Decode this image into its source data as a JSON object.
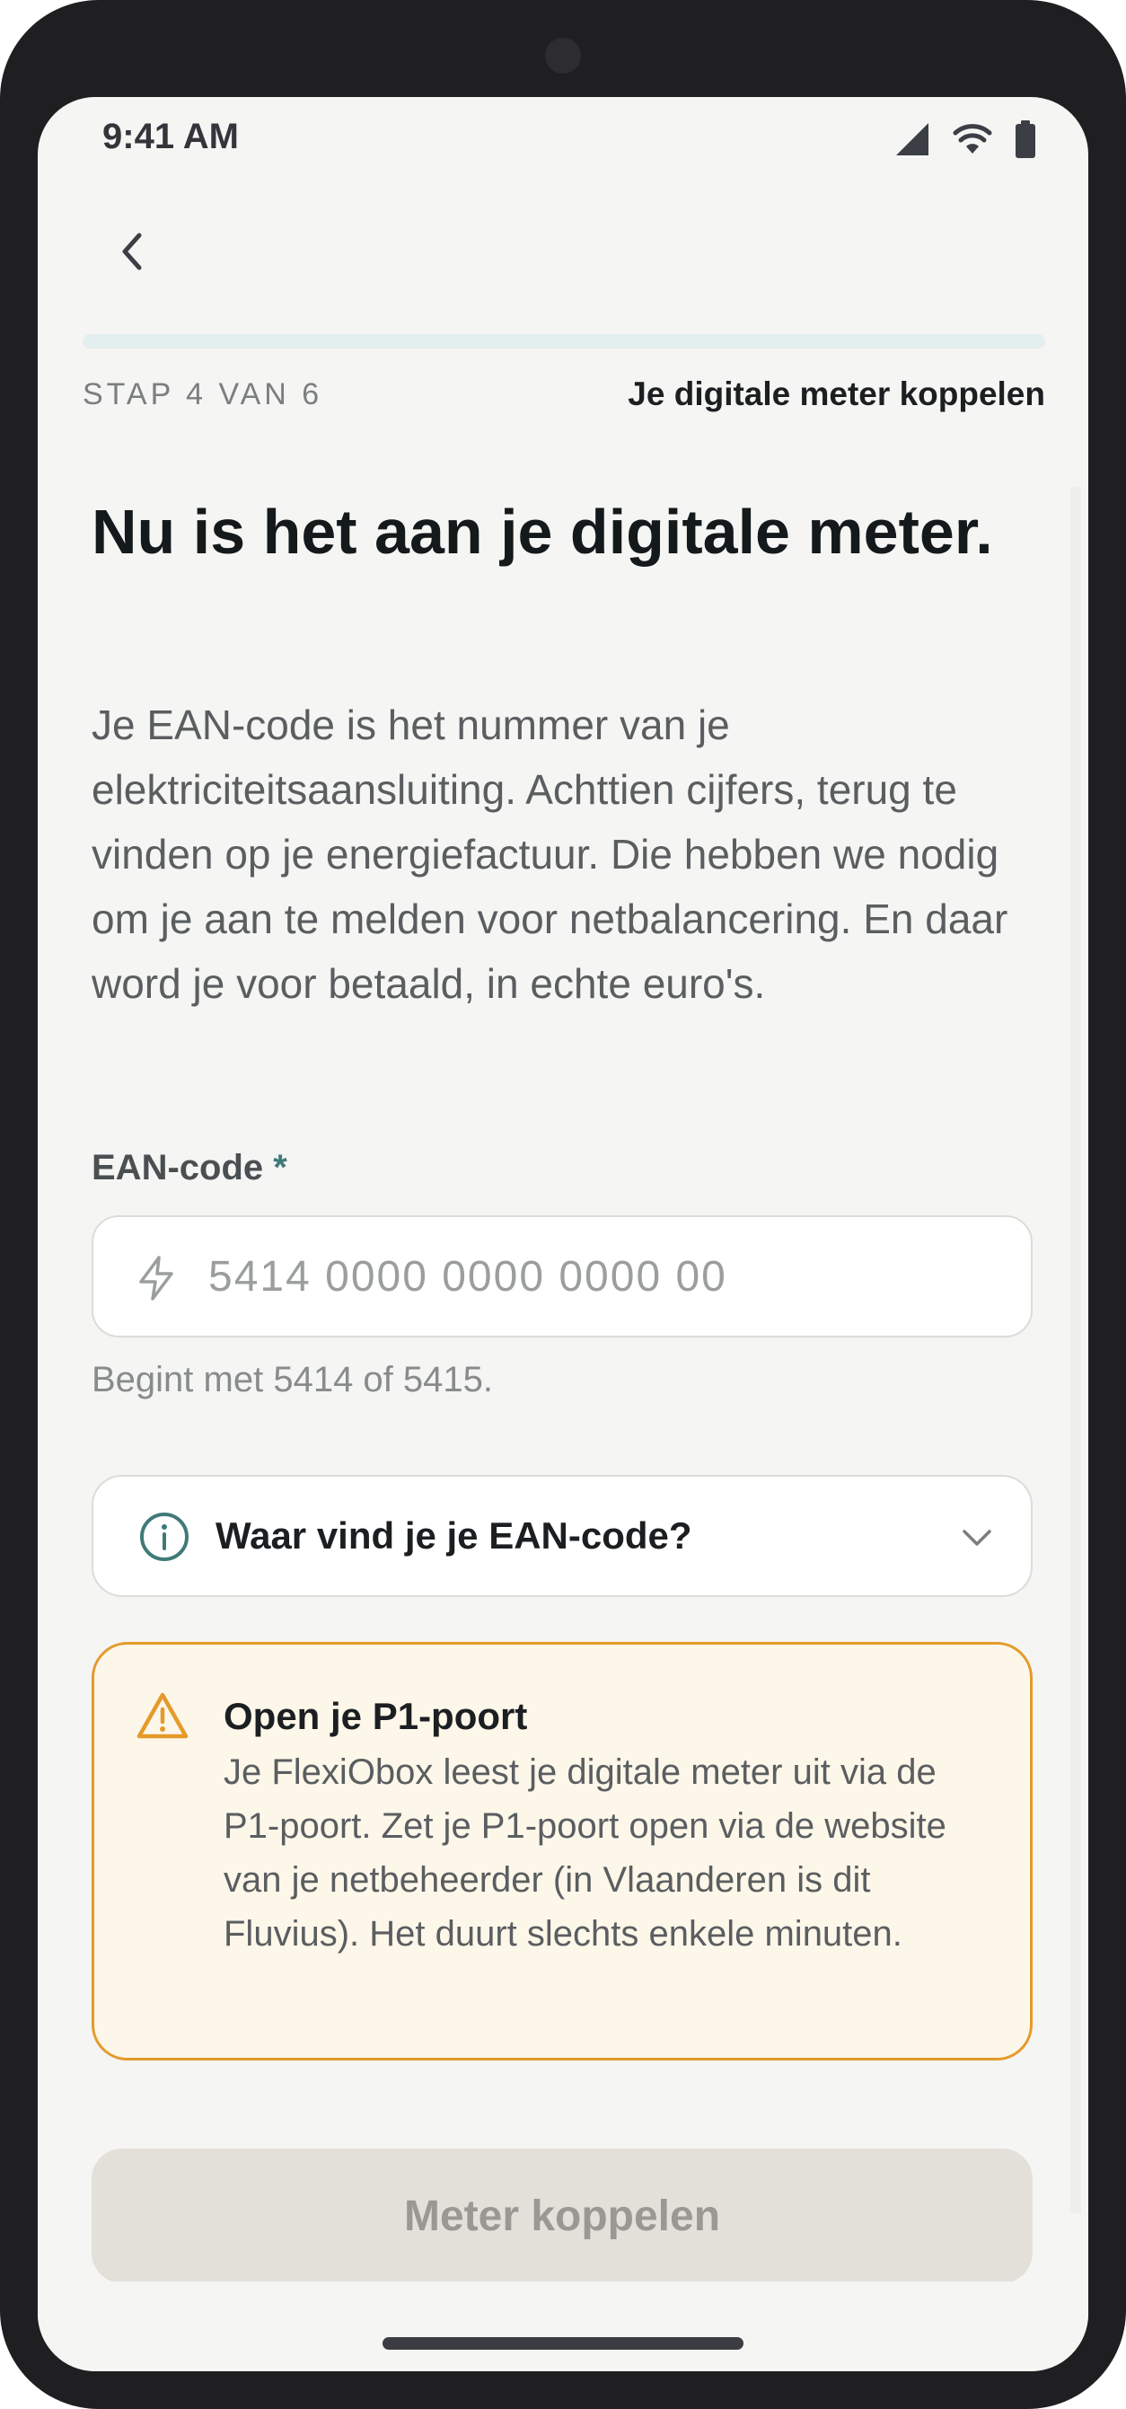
{
  "status_bar": {
    "time": "9:41 AM",
    "icons": [
      "signal-icon",
      "wifi-icon",
      "battery-icon"
    ]
  },
  "nav": {
    "back_icon": "chevron-left-icon"
  },
  "progress": {
    "step_text": "STAP 4 VAN 6",
    "step_name": "Je digitale meter koppelen",
    "current_step": 4,
    "total_steps": 6,
    "fill_fraction": 0.0
  },
  "content": {
    "heading": "Nu is het aan je digitale meter.",
    "intro": "Je EAN-code is het nummer van je elektriciteitsaansluiting. Achttien cijfers, terug te vinden op je energiefactuur. Die hebben we nodig om je aan te melden voor netbalancering. En daar word je voor betaald, in echte euro's."
  },
  "ean_field": {
    "label": "EAN-code",
    "required_mark": "*",
    "value": "",
    "placeholder": "5414 0000 0000 0000 00",
    "helper": "Begint met 5414 of 5415.",
    "icon": "bolt-icon"
  },
  "help_accordion": {
    "label": "Waar vind je je EAN-code?",
    "icon": "info-icon",
    "expanded": false
  },
  "warning": {
    "title": "Open je P1-poort",
    "body": "Je FlexiObox leest je digitale meter uit via de P1-poort. Zet je P1-poort open via de website van je netbeheerder (in Vlaanderen is dit Fluvius). Het duurt slechts enkele minuten.",
    "icon": "warning-icon"
  },
  "cta": {
    "label": "Meter koppelen",
    "disabled": true
  },
  "colors": {
    "accent": "#3f7a78",
    "warning_border": "#e59a2a",
    "warning_bg": "#fdf7ea",
    "background": "#f5f5f3",
    "disabled_button": "#e3e0da"
  }
}
